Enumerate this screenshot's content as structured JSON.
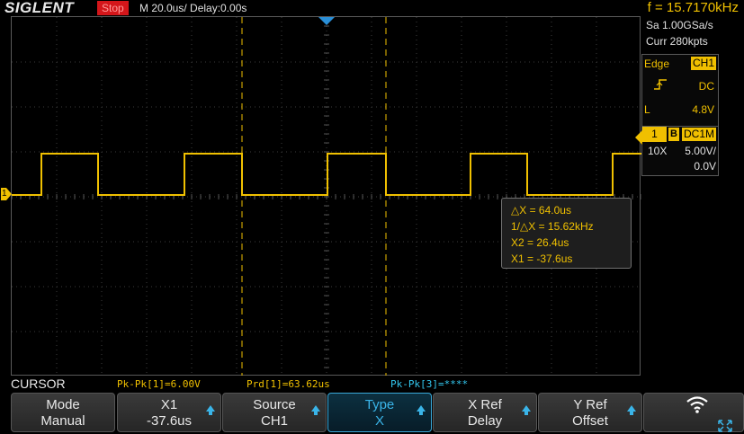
{
  "top": {
    "brand": "SIGLENT",
    "run_state": "Stop",
    "timebase": "M 20.0us/  Delay:0.00s",
    "frequency": "f = 15.7170kHz"
  },
  "acquisition": {
    "sample_rate": "Sa 1.00GSa/s",
    "memory": "Curr 280kpts"
  },
  "trigger": {
    "type": "Edge",
    "source": "CH1",
    "slope_icon": "rising-edge-icon",
    "coupling": "DC",
    "level_label": "L",
    "level_value": "4.8V"
  },
  "channel": {
    "number": "1",
    "bw_limit": "B",
    "coupling": "DC1M",
    "probe": "10X",
    "volts_per_div": "5.00V/",
    "offset": "0.0V",
    "marker_label": "1",
    "color": "#f0c000"
  },
  "cursor_readout": {
    "delta_x": "△X = 64.0us",
    "inv_delta_x": "1/△X = 15.62kHz",
    "x2": "X2 = 26.4us",
    "x1": "X1 = -37.6us"
  },
  "status": {
    "menu_title": "CURSOR",
    "meas1": "Pk-Pk[1]=6.00V",
    "meas2": "Prd[1]=63.62us",
    "meas3": "Pk-Pk[3]=****"
  },
  "softkeys": [
    {
      "line1": "Mode",
      "line2": "Manual",
      "arrow": false,
      "active": false
    },
    {
      "line1": "X1",
      "line2": "-37.6us",
      "arrow": true,
      "active": false
    },
    {
      "line1": "Source",
      "line2": "CH1",
      "arrow": true,
      "active": false
    },
    {
      "line1": "Type",
      "line2": "X",
      "arrow": true,
      "active": true
    },
    {
      "line1": "X Ref",
      "line2": "Delay",
      "arrow": true,
      "active": false
    },
    {
      "line1": "Y Ref",
      "line2": "Offset",
      "arrow": true,
      "active": false
    }
  ],
  "colors": {
    "trace": "#f0c000",
    "accent": "#3ab4e8",
    "stop": "#d4161a"
  }
}
